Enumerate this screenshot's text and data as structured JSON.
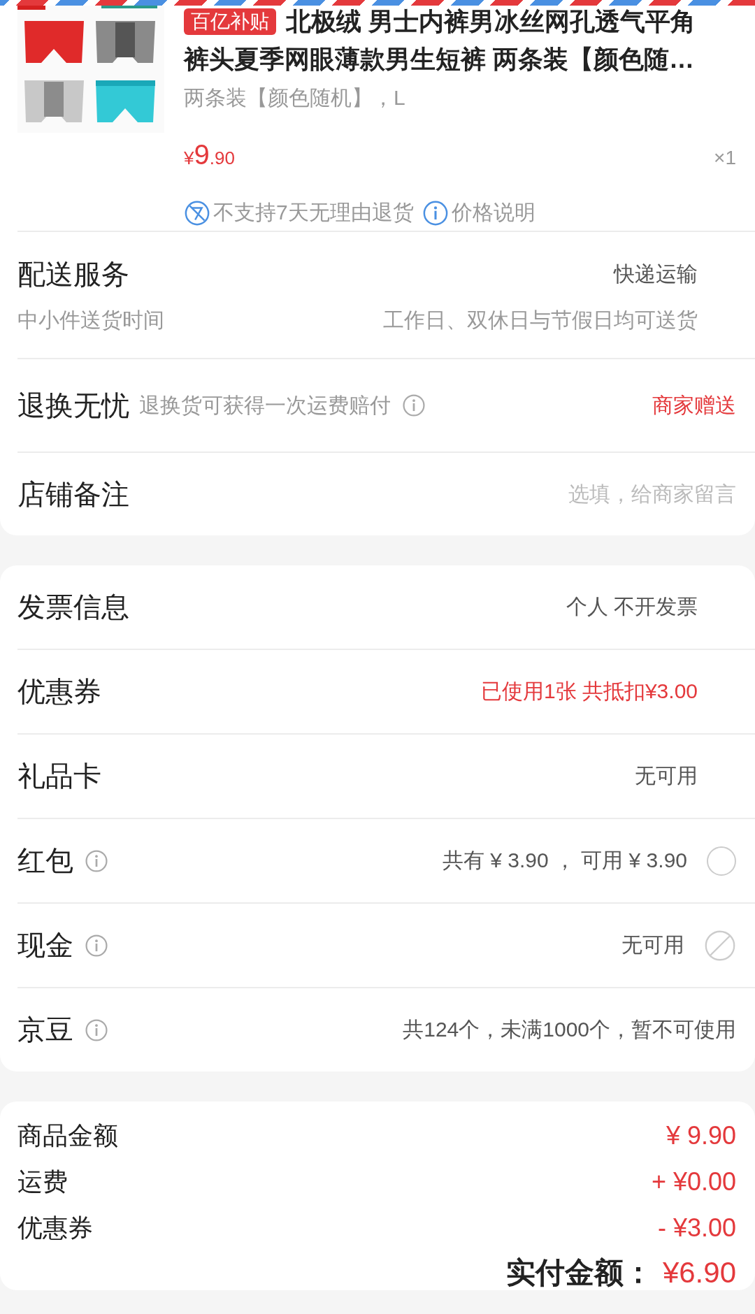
{
  "product": {
    "badge": "百亿补贴",
    "title": "北极绒 男士内裤男冰丝网孔透气平角裤头夏季网眼薄款男生短裤 两条装【颜色随…",
    "spec": "两条装【颜色随机】，L",
    "price_symbol": "¥",
    "price_integer": "9",
    "price_decimal": ".90",
    "quantity": "×1",
    "tags": [
      {
        "kind": "no-return",
        "text": "不支持7天无理由退货"
      },
      {
        "kind": "info",
        "text": "价格说明"
      }
    ]
  },
  "delivery": {
    "label": "配送服务",
    "value": "快递运输",
    "sub_label": "中小件送货时间",
    "sub_value": "工作日、双休日与节假日均可送货"
  },
  "return_service": {
    "label": "退换无忧",
    "description": "退换货可获得一次运费赔付",
    "value": "商家赠送"
  },
  "store_note": {
    "label": "店铺备注",
    "placeholder": "选填，给商家留言"
  },
  "options": [
    {
      "label": "发票信息",
      "value": "个人 不开发票",
      "kind": "link",
      "highlight": false,
      "info": false
    },
    {
      "label": "优惠券",
      "value": "已使用1张 共抵扣¥3.00",
      "kind": "link",
      "highlight": true,
      "info": false
    },
    {
      "label": "礼品卡",
      "value": "无可用",
      "kind": "link",
      "highlight": false,
      "info": false
    },
    {
      "label": "红包",
      "value": "共有 ¥ 3.90 ， 可用 ¥ 3.90",
      "kind": "radio",
      "checked": false,
      "highlight": false,
      "info": true
    },
    {
      "label": "现金",
      "value": "无可用",
      "kind": "unavailable",
      "highlight": false,
      "info": true
    },
    {
      "label": "京豆",
      "value": "共124个，未满1000个，暂不可使用",
      "kind": "plain",
      "highlight": false,
      "info": true
    }
  ],
  "summary": {
    "lines": [
      {
        "label": "商品金额",
        "value": "¥ 9.90"
      },
      {
        "label": "运费",
        "value": "+ ¥0.00"
      },
      {
        "label": "优惠券",
        "value": "- ¥3.00"
      }
    ],
    "total": {
      "label": "实付金额：",
      "value": "¥6.90"
    }
  }
}
